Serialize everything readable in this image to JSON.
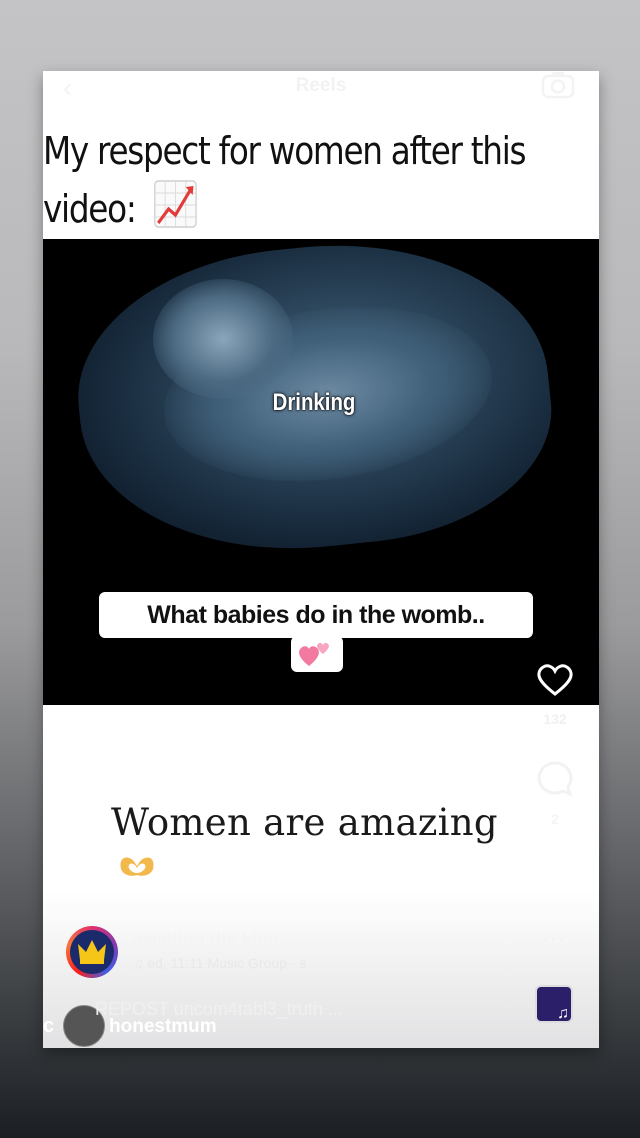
{
  "header": {
    "back_icon": "chevron-left-icon",
    "title": "Reels",
    "camera_icon": "camera-icon"
  },
  "post": {
    "caption_line1": "My respect for women after this",
    "caption_line2": "video:",
    "caption_emoji": "chart-increasing-emoji",
    "video_overlay_top": "Drinking",
    "video_overlay_bottom": "What babies do in the womb..",
    "video_overlay_emoji": "two-hearts-emoji",
    "bottom_text": "Women are amazing",
    "bottom_emoji": "heart-hands-emoji"
  },
  "actions": {
    "like_icon": "heart-icon",
    "like_count": "132",
    "comment_icon": "comment-icon",
    "comment_count": "2",
    "share_icon": "send-icon",
    "more_icon": "more-icon"
  },
  "author": {
    "username": "awaiting.the.king",
    "audio": "ed, 11:11 Music Group · s"
  },
  "repost": {
    "text": "REPOST uncom4tabl3_truth ...",
    "name": "honestmum",
    "cut_letter": "c"
  },
  "colors": {
    "white": "#ffffff",
    "scan_blue": "#40607a",
    "dark": "#000000"
  }
}
